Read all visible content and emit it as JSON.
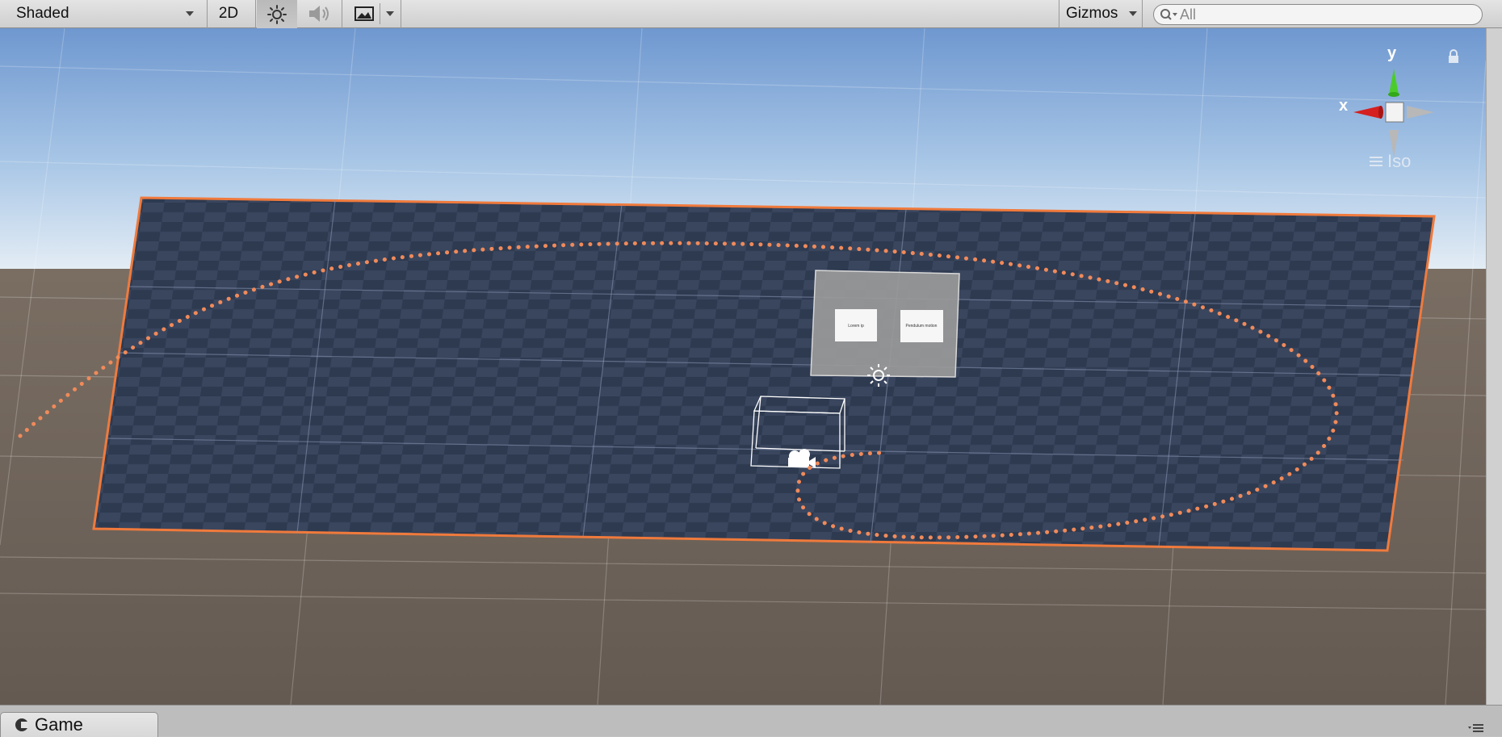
{
  "toolbar": {
    "draw_mode": "Shaded",
    "mode_2d": "2D",
    "gizmos": "Gizmos",
    "search_placeholder": "All"
  },
  "icons": {
    "lighting": "sun-icon",
    "audio": "speaker-icon",
    "effects": "image-icon",
    "lock": "lock-icon",
    "camera": "camera-icon",
    "light": "light-icon",
    "game": "game-tab-icon",
    "menu": "panel-menu-icon"
  },
  "scene_gizmo": {
    "y_label": "y",
    "x_label": "x",
    "projection": "Iso"
  },
  "canvas_panel": {
    "button1_text": "Lorem ip",
    "button2_text": "Pendulum motion"
  },
  "bottom": {
    "tab_label": "Game"
  },
  "colors": {
    "selection_outline": "#f07a3c",
    "path_dots": "#f08a5a",
    "ground": "#6b6058",
    "sky": "#8fb2dc",
    "gizmo_y": "#4ccc2c",
    "gizmo_x": "#d42020"
  }
}
